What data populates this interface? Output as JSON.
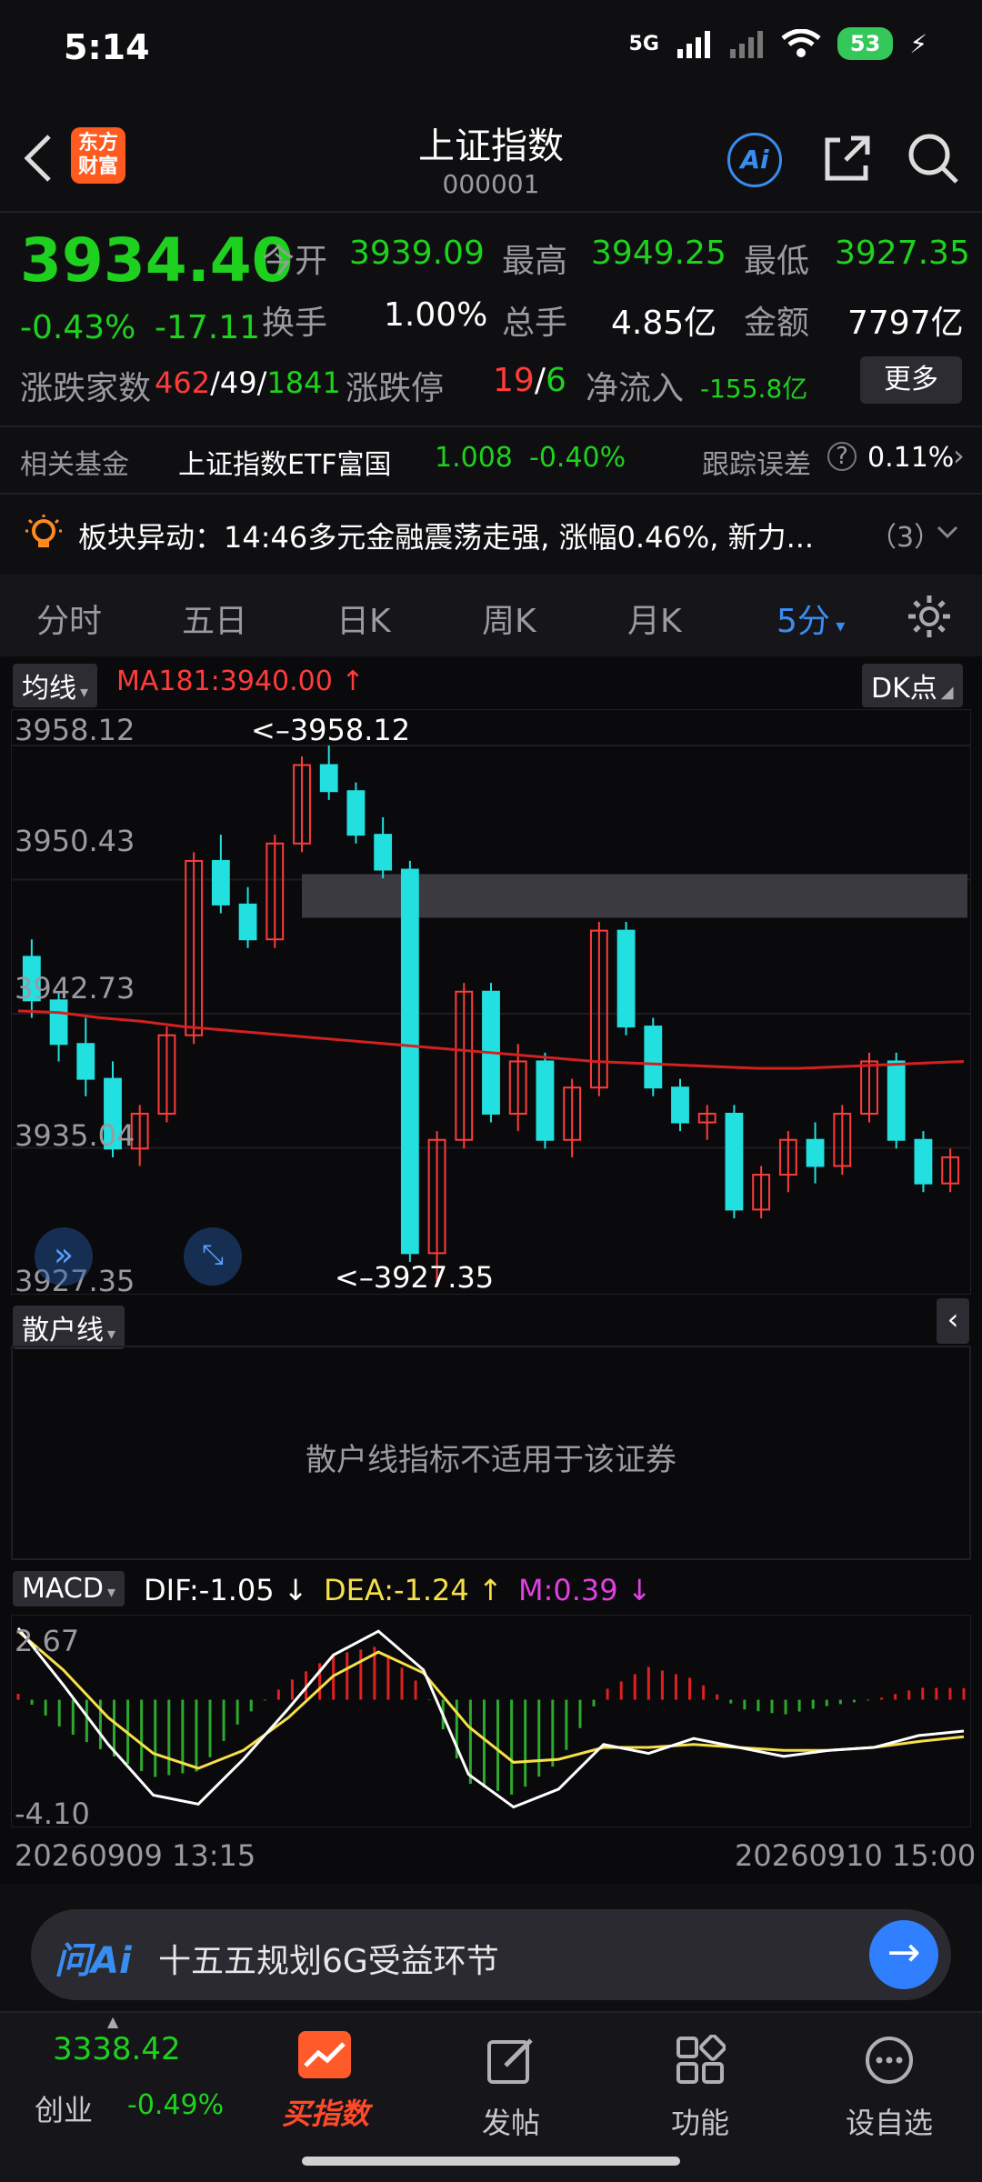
{
  "status": {
    "time": "5:14",
    "network": "5G",
    "battery": "53"
  },
  "header": {
    "title": "上证指数",
    "code": "000001",
    "logo_text": "东方\n财富",
    "ai_label": "Ai"
  },
  "quote": {
    "price": "3934.40",
    "change_pct": "-0.43%",
    "change_abs": "-17.11",
    "open_label": "今开",
    "open": "3939.09",
    "high_label": "最高",
    "high": "3949.25",
    "low_label": "最低",
    "low": "3927.35",
    "turnover_label": "换手",
    "turnover": "1.00%",
    "volume_label": "总手",
    "volume": "4.85亿",
    "amount_label": "金额",
    "amount": "7797亿",
    "breadth_label": "涨跌家数",
    "breadth_up": "462",
    "breadth_flat": "49",
    "breadth_down": "1841",
    "limit_label": "涨跌停",
    "limit_up": "19",
    "limit_down": "6",
    "netflow_label": "净流入",
    "netflow": "-155.8亿",
    "more_label": "更多"
  },
  "fund": {
    "label": "相关基金",
    "name": "上证指数ETF富国",
    "price": "1.008",
    "change": "-0.40%",
    "tracking_label": "跟踪误差",
    "tracking": "0.11%"
  },
  "news": {
    "text": "板块异动：14:46多元金融震荡走强, 涨幅0.46%, 新力...",
    "count": "（3）"
  },
  "tabs": [
    "分时",
    "五日",
    "日K",
    "周K",
    "月K",
    "5分"
  ],
  "chart": {
    "ma_selector": "均线",
    "ma_label": "MA181:3940.00",
    "ma_arrow": "↑",
    "dk_label": "DK点",
    "y_labels": [
      "3958.12",
      "3950.43",
      "3942.73",
      "3935.04",
      "3927.35"
    ],
    "max_marker": "<–3958.12",
    "min_marker": "<–3927.35",
    "retail_selector": "散户线",
    "retail_message": "散户线指标不适用于该证券",
    "macd_selector": "MACD",
    "dif_label": "DIF:-1.05",
    "dif_arrow": "↓",
    "dea_label": "DEA:-1.24",
    "dea_arrow": "↑",
    "m_label": "M:0.39",
    "m_arrow": "↓",
    "macd_top": "2.67",
    "macd_bottom": "-4.10",
    "start_time": "20260909 13:15",
    "end_time": "20260910 15:00",
    "colors": {
      "up": "#ff3b3b",
      "down": "#22e0e0",
      "ma": "#d42020",
      "dif": "#ffffff",
      "dea": "#f5e04a",
      "m": "#e040e0"
    }
  },
  "ai_search": {
    "logo": "问Ai",
    "text": "十五五规划6G受益环节"
  },
  "bottom_nav": {
    "index_value": "3338.42",
    "index_name": "创业",
    "index_change": "-0.49%",
    "items": [
      "买指数",
      "发帖",
      "功能",
      "设自选"
    ]
  },
  "chart_data": {
    "type": "candlestick",
    "y_range": [
      3927.35,
      3958.12
    ],
    "ma_value": 3940.0,
    "ma_series": [
      3942.9,
      3942.8,
      3942.5,
      3942.3,
      3942.0,
      3941.8,
      3941.6,
      3941.4,
      3941.2,
      3941.0,
      3940.8,
      3940.6,
      3940.4,
      3940.2,
      3940.0,
      3939.9,
      3939.8,
      3939.7,
      3939.6,
      3939.6,
      3939.7,
      3939.8,
      3939.9,
      3940.0
    ],
    "candles": [
      [
        3946.0,
        3947.0,
        3942.5,
        3943.5
      ],
      [
        3943.5,
        3944.0,
        3940.0,
        3941.0
      ],
      [
        3941.0,
        3942.5,
        3938.0,
        3939.0
      ],
      [
        3939.0,
        3940.0,
        3934.5,
        3935.0
      ],
      [
        3935.0,
        3937.5,
        3934.0,
        3937.0
      ],
      [
        3937.0,
        3942.0,
        3936.5,
        3941.5
      ],
      [
        3941.5,
        3952.0,
        3941.0,
        3951.5
      ],
      [
        3951.5,
        3953.0,
        3948.5,
        3949.0
      ],
      [
        3949.0,
        3950.0,
        3946.5,
        3947.0
      ],
      [
        3947.0,
        3953.0,
        3946.5,
        3952.5
      ],
      [
        3952.5,
        3957.5,
        3952.0,
        3957.0
      ],
      [
        3957.0,
        3958.12,
        3955.0,
        3955.5
      ],
      [
        3955.5,
        3956.0,
        3952.5,
        3953.0
      ],
      [
        3953.0,
        3954.0,
        3950.5,
        3951.0
      ],
      [
        3951.0,
        3951.5,
        3928.5,
        3929.0
      ],
      [
        3929.0,
        3936.0,
        3927.35,
        3935.5
      ],
      [
        3935.5,
        3944.5,
        3935.0,
        3944.0
      ],
      [
        3944.0,
        3944.5,
        3936.5,
        3937.0
      ],
      [
        3937.0,
        3941.0,
        3936.0,
        3940.0
      ],
      [
        3940.0,
        3940.5,
        3935.0,
        3935.5
      ],
      [
        3935.5,
        3939.0,
        3934.5,
        3938.5
      ],
      [
        3938.5,
        3948.0,
        3938.0,
        3947.5
      ],
      [
        3947.5,
        3948.0,
        3941.5,
        3942.0
      ],
      [
        3942.0,
        3942.5,
        3938.0,
        3938.5
      ],
      [
        3938.5,
        3939.0,
        3936.0,
        3936.5
      ],
      [
        3936.5,
        3937.5,
        3935.5,
        3937.0
      ],
      [
        3937.0,
        3937.5,
        3931.0,
        3931.5
      ],
      [
        3931.5,
        3934.0,
        3931.0,
        3933.5
      ],
      [
        3933.5,
        3936.0,
        3932.5,
        3935.5
      ],
      [
        3935.5,
        3936.5,
        3933.0,
        3934.0
      ],
      [
        3934.0,
        3937.5,
        3933.5,
        3937.0
      ],
      [
        3937.0,
        3940.5,
        3936.5,
        3940.0
      ],
      [
        3940.0,
        3940.5,
        3935.0,
        3935.5
      ],
      [
        3935.5,
        3936.0,
        3932.5,
        3933.0
      ],
      [
        3933.0,
        3935.0,
        3932.5,
        3934.5
      ]
    ],
    "macd": {
      "range": [
        -4.1,
        2.67
      ],
      "dif": [
        2.4,
        0.5,
        -1.5,
        -3.2,
        -3.5,
        -2.0,
        -0.3,
        1.5,
        2.3,
        1.0,
        -2.5,
        -3.6,
        -3.0,
        -1.5,
        -1.8,
        -1.3,
        -1.6,
        -1.9,
        -1.7,
        -1.6,
        -1.2,
        -1.05
      ],
      "dea": [
        2.3,
        1.0,
        -0.6,
        -1.8,
        -2.3,
        -1.7,
        -0.6,
        0.8,
        1.6,
        0.9,
        -0.9,
        -2.1,
        -2.0,
        -1.6,
        -1.6,
        -1.5,
        -1.6,
        -1.7,
        -1.7,
        -1.6,
        -1.4,
        -1.24
      ],
      "m": [
        0.2,
        -1.0,
        -1.8,
        -2.6,
        -2.4,
        -0.6,
        0.6,
        1.5,
        1.8,
        0.4,
        -2.8,
        -3.2,
        -2.1,
        0.3,
        1.1,
        0.7,
        -0.3,
        -0.5,
        -0.2,
        0.0,
        0.4,
        0.39
      ]
    }
  }
}
